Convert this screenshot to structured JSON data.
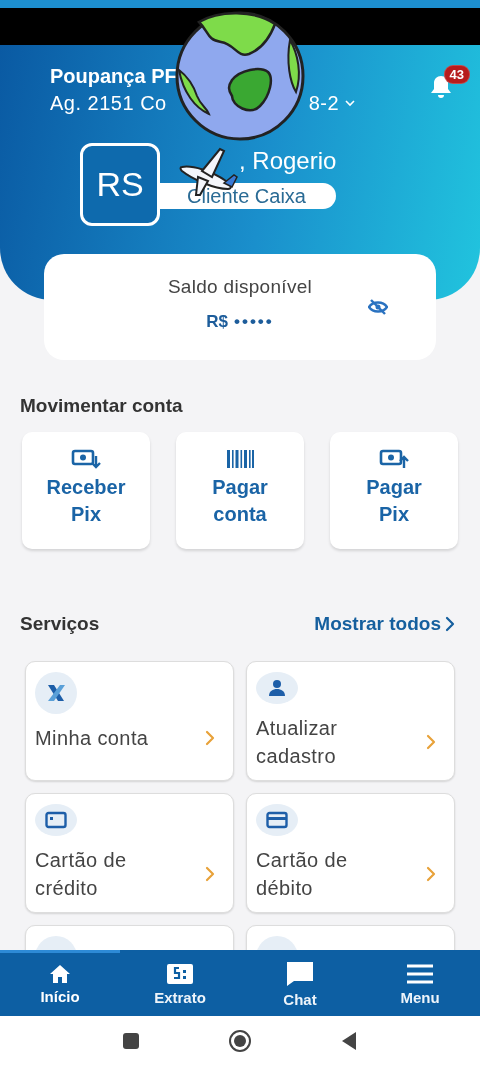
{
  "account": {
    "name": "Poupança PF",
    "agency_start": "Ag. 2151 Co",
    "agency_end": "8-2",
    "notification_count": "43"
  },
  "profile": {
    "initials": "RS",
    "greeting": ", Rogerio",
    "segment": "Cliente Caixa"
  },
  "balance": {
    "label": "Saldo disponível",
    "currency": "R$",
    "masked_value": "•••••"
  },
  "movimentar": {
    "title": "Movimentar conta",
    "actions": [
      {
        "line1": "Receber",
        "line2": "Pix"
      },
      {
        "line1": "Pagar",
        "line2": "conta"
      },
      {
        "line1": "Pagar",
        "line2": "Pix"
      }
    ]
  },
  "servicos": {
    "title": "Serviços",
    "show_all": "Mostrar todos",
    "items": [
      {
        "kind": "service",
        "label": "Minha conta"
      },
      {
        "kind": "service",
        "label": "Atualizar cadastro"
      },
      {
        "kind": "service",
        "label": "Cartão de crédito"
      },
      {
        "kind": "service",
        "label": "Cartão de débito"
      },
      {
        "kind": "partial"
      },
      {
        "kind": "partial"
      }
    ]
  },
  "bottom_nav": [
    {
      "label": "Início",
      "selected": true
    },
    {
      "label": "Extrato",
      "selected": false
    },
    {
      "label": "Chat",
      "selected": false
    },
    {
      "label": "Menu",
      "selected": false
    }
  ]
}
